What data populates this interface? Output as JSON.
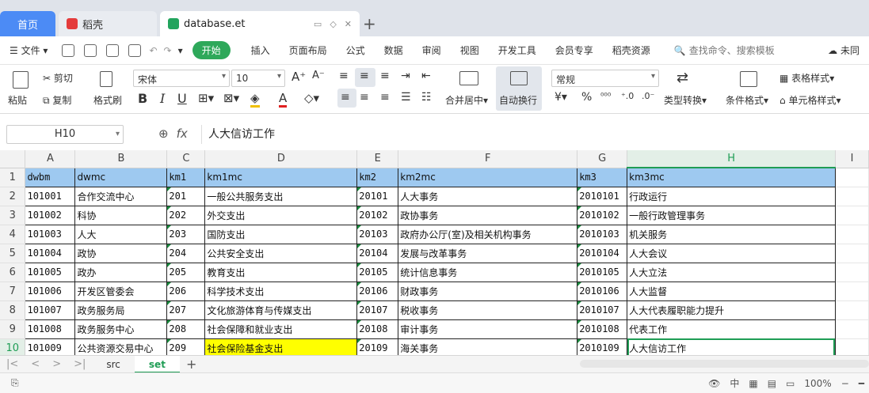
{
  "tabs": [
    {
      "label": "首页"
    },
    {
      "label": "稻壳"
    },
    {
      "label": "database.et"
    }
  ],
  "menu": {
    "file": "文件",
    "start": "开始",
    "items": [
      "插入",
      "页面布局",
      "公式",
      "数据",
      "审阅",
      "视图",
      "开发工具",
      "会员专享",
      "稻壳资源"
    ],
    "search": "查找命令、搜索模板",
    "sync": "未同"
  },
  "ribbon": {
    "paste": "粘贴",
    "cut": "剪切",
    "copy": "复制",
    "format_painter": "格式刷",
    "font_name": "宋体",
    "font_size": "10",
    "merge": "合并居中",
    "wrap": "自动换行",
    "number_format": "常规",
    "type_convert": "类型转换",
    "cond_format": "条件格式",
    "table_style": "表格样式",
    "cell_style": "单元格样式"
  },
  "formula": {
    "cell_ref": "H10",
    "content": "人大信访工作"
  },
  "columns": [
    "A",
    "B",
    "C",
    "D",
    "E",
    "F",
    "G",
    "H",
    "I"
  ],
  "rows": [
    [
      "dwbm",
      "dwmc",
      "km1",
      "km1mc",
      "km2",
      "km2mc",
      "km3",
      "km3mc"
    ],
    [
      "101001",
      "合作交流中心",
      "201",
      "一般公共服务支出",
      "20101",
      "人大事务",
      "2010101",
      "行政运行"
    ],
    [
      "101002",
      "科协",
      "202",
      "外交支出",
      "20102",
      "政协事务",
      "2010102",
      "一般行政管理事务"
    ],
    [
      "101003",
      "人大",
      "203",
      "国防支出",
      "20103",
      "政府办公厅(室)及相关机构事务",
      "2010103",
      "机关服务"
    ],
    [
      "101004",
      "政协",
      "204",
      "公共安全支出",
      "20104",
      "发展与改革事务",
      "2010104",
      "人大会议"
    ],
    [
      "101005",
      "政办",
      "205",
      "教育支出",
      "20105",
      "统计信息事务",
      "2010105",
      "人大立法"
    ],
    [
      "101006",
      "开发区管委会",
      "206",
      "科学技术支出",
      "20106",
      "财政事务",
      "2010106",
      "人大监督"
    ],
    [
      "101007",
      "政务服务局",
      "207",
      "文化旅游体育与传媒支出",
      "20107",
      "税收事务",
      "2010107",
      "人大代表履职能力提升"
    ],
    [
      "101008",
      "政务服务中心",
      "208",
      "社会保障和就业支出",
      "20108",
      "审计事务",
      "2010108",
      "代表工作"
    ],
    [
      "101009",
      "公共资源交易中心",
      "209",
      "社会保险基金支出",
      "20109",
      "海关事务",
      "2010109",
      "人大信访工作"
    ]
  ],
  "sheets": [
    "src",
    "set"
  ],
  "status": {
    "zoom": "100%",
    "lang": "中"
  }
}
